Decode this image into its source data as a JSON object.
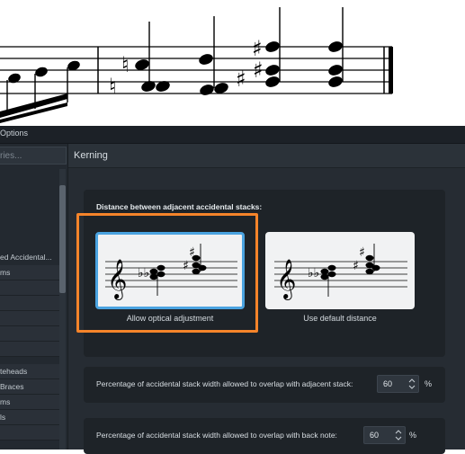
{
  "window": {
    "title": "Options"
  },
  "sidebar": {
    "search_placeholder": "ries...",
    "items": [
      {
        "label": "ed Accidental..."
      },
      {
        "label": "ms"
      },
      {
        "label": ""
      },
      {
        "label": ""
      },
      {
        "label": ""
      },
      {
        "label": ""
      },
      {
        "label": ""
      },
      {
        "label": "teheads"
      },
      {
        "label": "Braces"
      },
      {
        "label": "ms"
      },
      {
        "label": "ls"
      },
      {
        "label": ""
      }
    ]
  },
  "content": {
    "section_title": "Kerning",
    "distance_label": "Distance between adjacent accidental stacks:",
    "options": [
      {
        "caption": "Allow optical adjustment",
        "selected": true
      },
      {
        "caption": "Use default distance",
        "selected": false
      }
    ],
    "adjacent_overlap": {
      "label": "Percentage of accidental stack width allowed to overlap with adjacent stack:",
      "value": "60",
      "unit": "%"
    },
    "back_overlap": {
      "label": "Percentage of accidental stack width allowed to overlap with back note:",
      "value": "60",
      "unit": "%"
    }
  },
  "colors": {
    "selection_border": "#4aa3e0",
    "highlight": "#f5842a",
    "dialog_bg": "#262c33"
  }
}
